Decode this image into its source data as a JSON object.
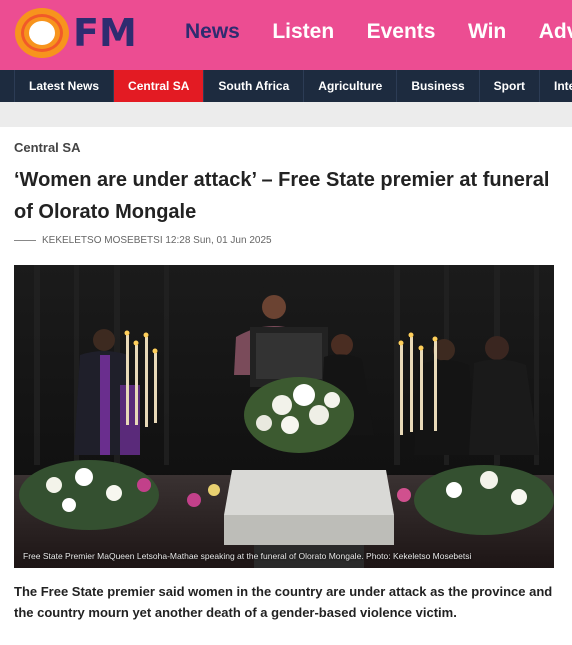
{
  "header": {
    "logo_text": "FM",
    "nav": [
      "News",
      "Listen",
      "Events",
      "Win",
      "Adve"
    ],
    "colors": {
      "background": "#ec4d92",
      "nav_text": "#2e2c70"
    }
  },
  "subnav": {
    "tabs": [
      "Latest News",
      "Central SA",
      "South Africa",
      "Agriculture",
      "Business",
      "Sport",
      "Interna"
    ],
    "active": "Central SA",
    "colors": {
      "background": "#1d2b3f",
      "active": "#e31b23"
    }
  },
  "article": {
    "section": "Central SA",
    "headline": "‘Women are under attack’ – Free State premier at funeral of Olorato Mongale",
    "byline": "KEKELETSO MOSEBETSI 12:28 Sun, 01 Jun 2025",
    "photo_caption": "Free State Premier MaQueen Letsoha-Mathae speaking at the funeral of Olorato Mongale. Photo: Kekeletso Mosebetsi",
    "lede": "The Free State premier said women in the country are under attack as the province and the country mourn yet another death of a gender-based violence victim."
  }
}
